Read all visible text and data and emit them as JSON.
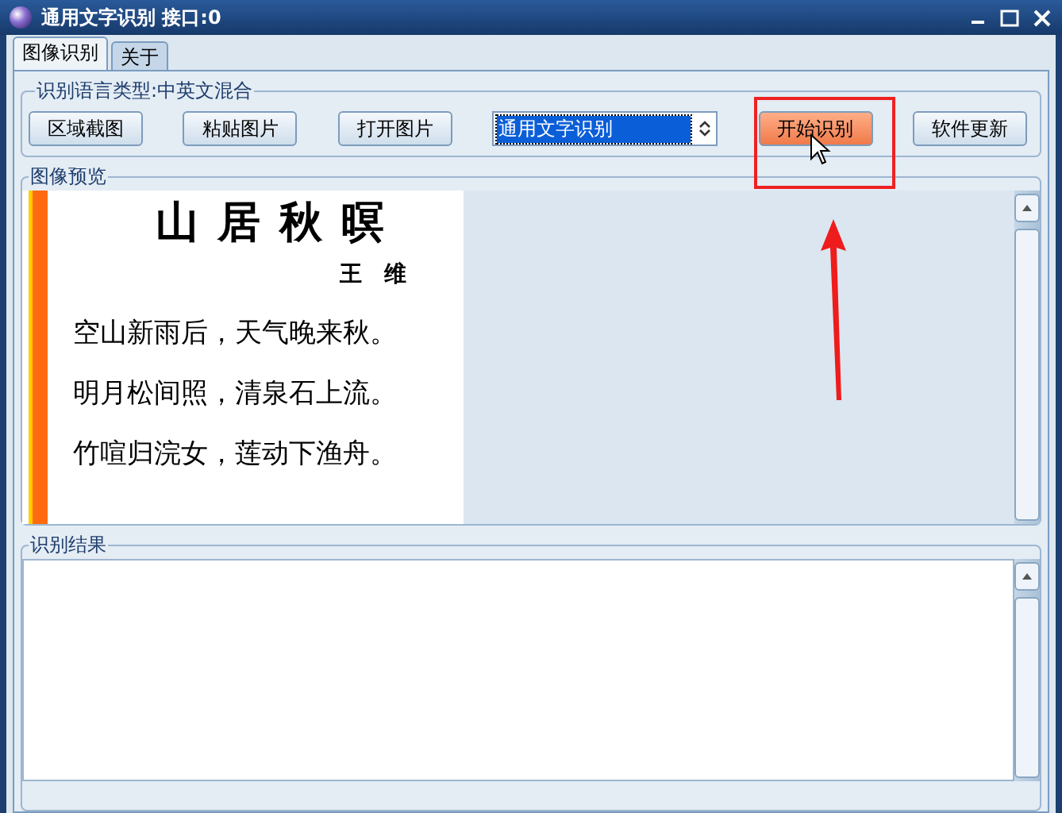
{
  "window": {
    "title": "通用文字识别 接口:0"
  },
  "tabs": [
    {
      "label": "图像识别",
      "selected": true
    },
    {
      "label": "关于",
      "selected": false
    }
  ],
  "language_group": {
    "legend": "识别语言类型:中英文混合"
  },
  "toolbar": [
    {
      "kind": "button",
      "label": "区域截图"
    },
    {
      "kind": "button",
      "label": "粘贴图片"
    },
    {
      "kind": "button",
      "label": "打开图片"
    },
    {
      "kind": "select",
      "value": "通用文字识别"
    },
    {
      "kind": "primary",
      "label": "开始识别"
    },
    {
      "kind": "button",
      "label": "软件更新"
    }
  ],
  "preview": {
    "legend": "图像预览",
    "document": {
      "title": "山居秋暝",
      "author": "王　维",
      "lines": [
        "空山新雨后，天气晚来秋。",
        "明月松间照，清泉石上流。",
        "竹喧归浣女，莲动下渔舟。"
      ]
    }
  },
  "result": {
    "legend": "识别结果"
  }
}
